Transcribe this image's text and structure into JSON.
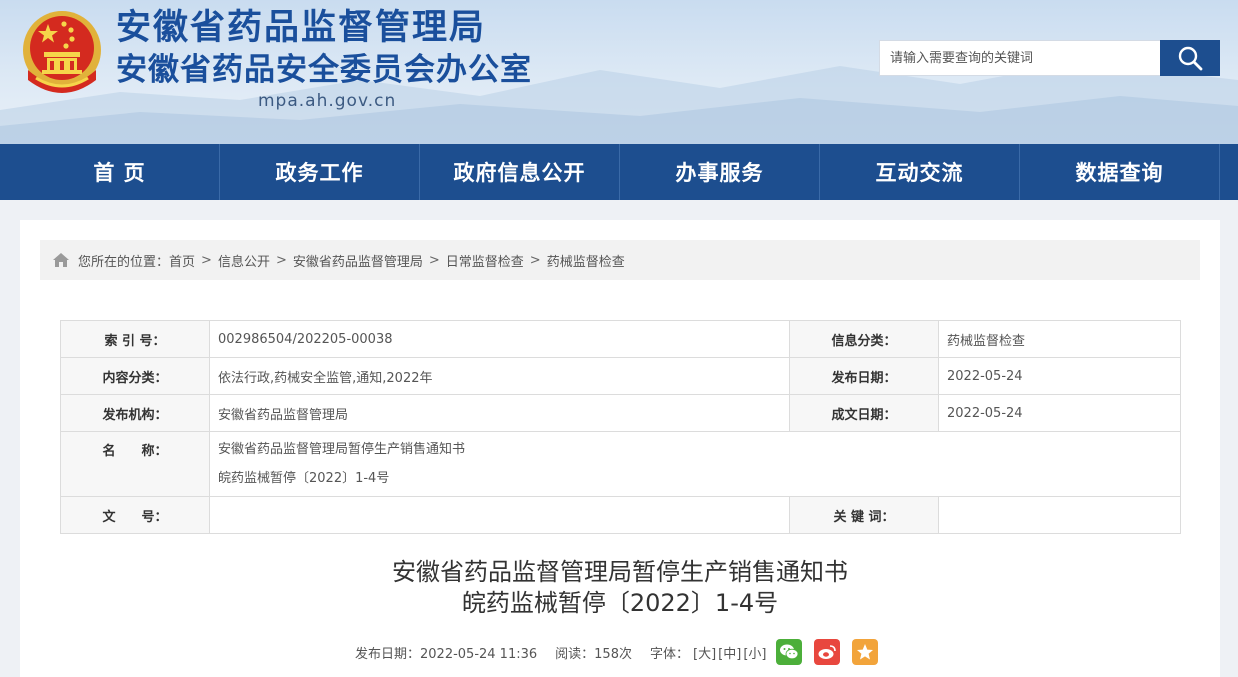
{
  "header": {
    "title": "安徽省药品监督管理局",
    "subtitle": "安徽省药品安全委员会办公室",
    "domain": "mpa.ah.gov.cn",
    "search_placeholder": "请输入需要查询的关键词"
  },
  "nav": {
    "items": [
      {
        "label": "首 页"
      },
      {
        "label": "政务工作"
      },
      {
        "label": "政府信息公开"
      },
      {
        "label": "办事服务"
      },
      {
        "label": "互动交流"
      },
      {
        "label": "数据查询"
      }
    ]
  },
  "breadcrumb": {
    "prefix": "您所在的位置：",
    "items": [
      "首页",
      "信息公开",
      "安徽省药品监督管理局",
      "日常监督检查",
      "药械监督检查"
    ],
    "separator": ">"
  },
  "meta": {
    "index_label": "索 引 号：",
    "index_value": "002986504/202205-00038",
    "info_cat_label": "信息分类：",
    "info_cat_value": "药械监督检查",
    "content_cat_label": "内容分类：",
    "content_cat_value": "依法行政,药械安全监管,通知,2022年",
    "pub_date_label": "发布日期：",
    "pub_date_value": "2022-05-24",
    "org_label": "发布机构：",
    "org_value": "安徽省药品监督管理局",
    "made_date_label": "成文日期：",
    "made_date_value": "2022-05-24",
    "name_label": "名　　称：",
    "name_line1": "安徽省药品监督管理局暂停生产销售通知书",
    "name_line2": "皖药监械暂停〔2022〕1-4号",
    "doc_no_label": "文　　号：",
    "doc_no_value": "",
    "keywords_label": "关 键 词：",
    "keywords_value": ""
  },
  "article": {
    "title_line1": "安徽省药品监督管理局暂停生产销售通知书",
    "title_line2": "皖药监械暂停〔2022〕1-4号",
    "pub_date": "发布日期：2022-05-24 11:36",
    "reads": "阅读：158次",
    "font_label": "字体：",
    "font_large": "[大]",
    "font_medium": "[中]",
    "font_small": "[小]"
  },
  "colors": {
    "brand_blue": "#1d4e8f",
    "title_blue": "#1a4f9c",
    "wechat_green": "#4caf3a",
    "weibo_red": "#e8473e",
    "fav_orange": "#f2a43b"
  }
}
